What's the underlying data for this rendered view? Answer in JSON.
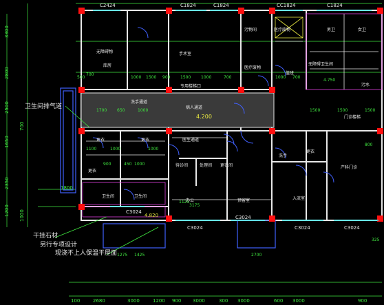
{
  "window_labels_top": [
    "C2424",
    "C1824",
    "C1824",
    "CC1824",
    "C1824"
  ],
  "window_labels_bottom": [
    "C3024",
    "C3024",
    "C3024",
    "C3024",
    "C3024",
    "C3024"
  ],
  "top_dims": [
    "700",
    "500",
    "1000",
    "1500",
    "900",
    "1500",
    "1000",
    "700",
    "1000",
    "700",
    "1500",
    "1500"
  ],
  "left_dims": [
    "3300",
    "2800",
    "2500",
    "1650",
    "2350",
    "1200",
    "1000",
    "1800",
    "700"
  ],
  "bottom_dims": [
    "100",
    "2680",
    "3000",
    "1200",
    "900",
    "3000",
    "300",
    "3000",
    "600",
    "3000",
    "900"
  ],
  "small_dims": [
    "1700",
    "650",
    "1000",
    "900",
    "1000",
    "4.200",
    "1100",
    "1000",
    "450",
    "1000",
    "4.820",
    "1275",
    "1425",
    "2700",
    "1125",
    "3175",
    "4.750",
    "325",
    "1500",
    "800"
  ],
  "rooms": {
    "r1": "无障碍物",
    "r2": "库房",
    "r3": "手术室",
    "r4": "洗手通道",
    "r5": "病人通道",
    "r6": "医生通道",
    "r7": "更衣",
    "r8": "更衣",
    "r9": "卫生间",
    "r10": "卫生间",
    "r11": "值班",
    "r12": "污物间",
    "r13": "医疗废物",
    "r14": "处理间",
    "r15": "更衣间",
    "r16": "办公",
    "r17": "预留室",
    "r18": "洗手",
    "r19": "更衣",
    "r20": "入流室",
    "r21": "产科门诊",
    "r22": "无障碍卫生间",
    "r23": "门诊楼梯",
    "r24": "男卫",
    "r25": "女卫",
    "r26": "专用楼梯口",
    "r27": "医疗废物",
    "r28": "待诊间",
    "r29": "更衣",
    "r30": "污水"
  },
  "annotations": {
    "a1": "卫生间排气道",
    "a2": "干挂石材",
    "a3": "另行专项设计",
    "a4": "现浇不上人保温平屋面"
  },
  "colors": {
    "wall": "#e8e8e8",
    "column": "#ff1010",
    "dimension": "#40e840",
    "window": "#40e8e8",
    "axis": "#e040e0",
    "hatch": "#9a9a9a",
    "door": "#4060ff"
  }
}
